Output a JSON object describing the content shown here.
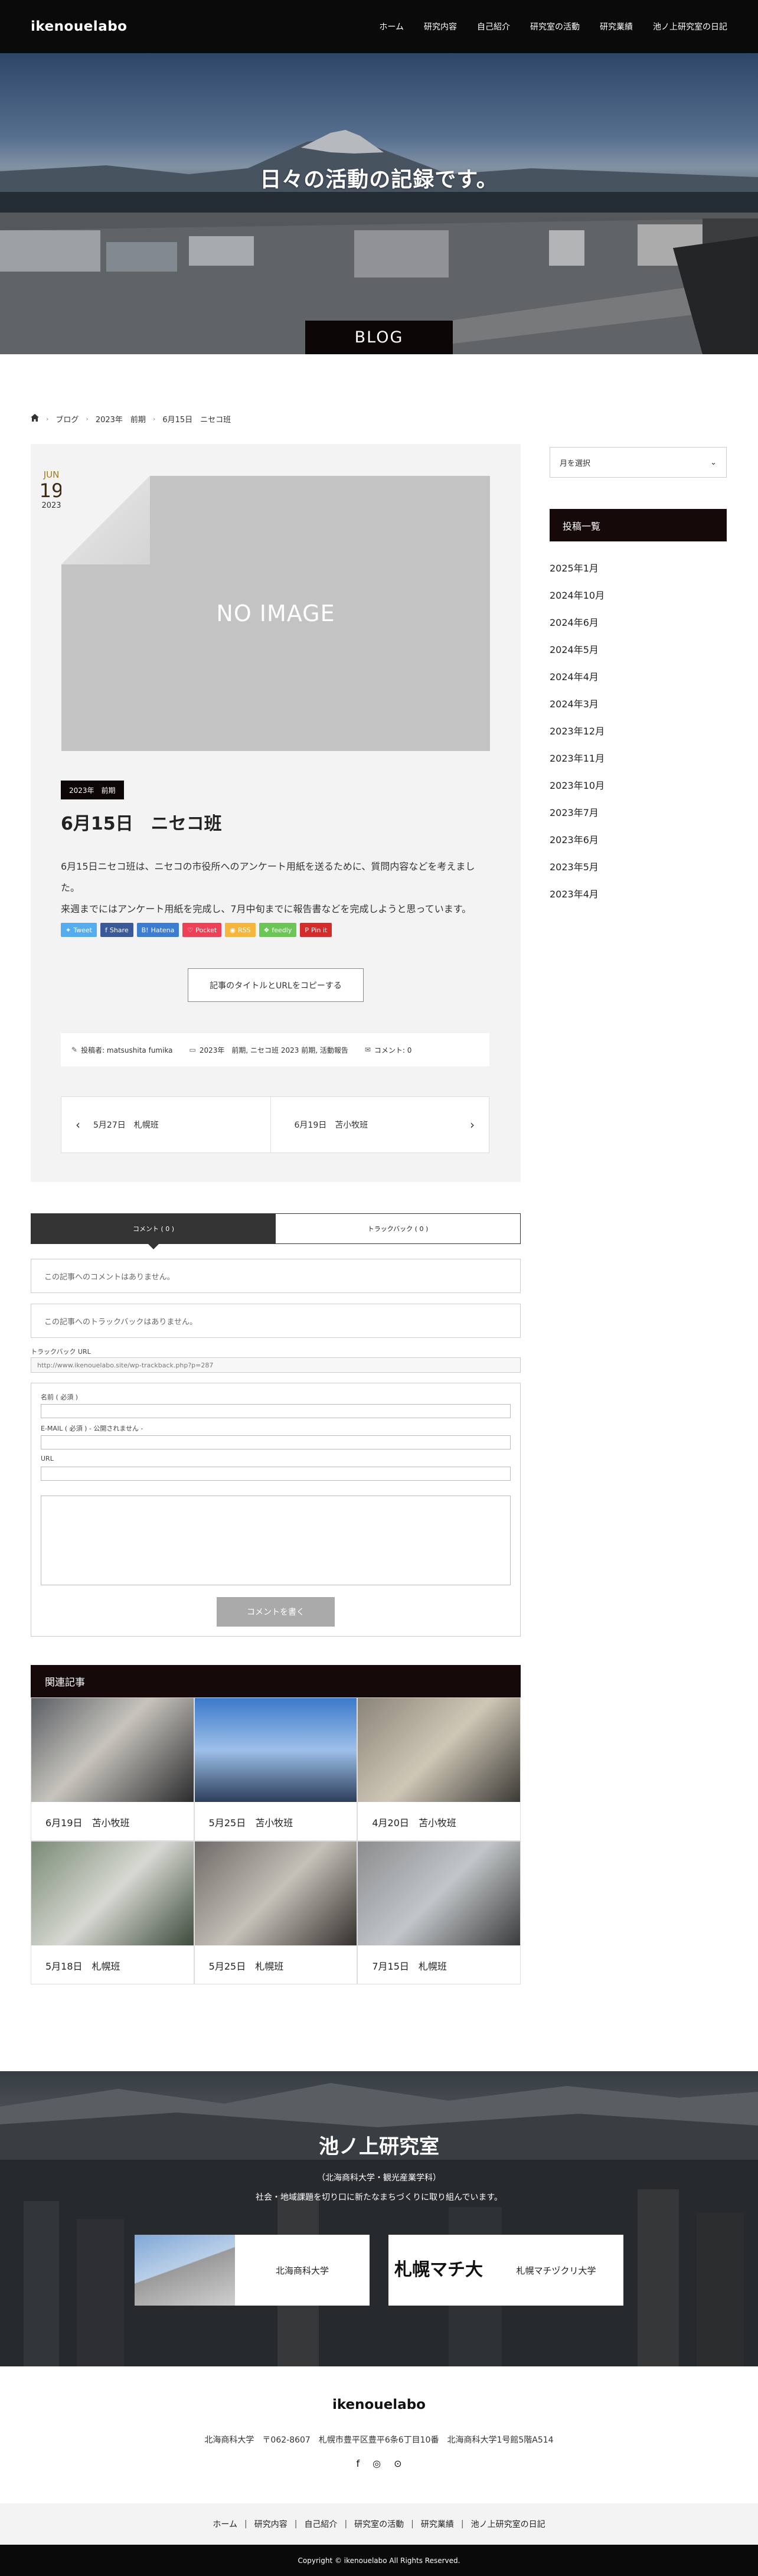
{
  "header": {
    "logo": "ikenouelabo",
    "nav": [
      "ホーム",
      "研究内容",
      "自己紹介",
      "研究室の活動",
      "研究業績",
      "池ノ上研究室の日記"
    ]
  },
  "hero": {
    "title": "日々の活動の記録です。",
    "tag": "BLOG"
  },
  "breadcrumb": {
    "home_icon": "home-icon",
    "items": [
      "ブログ",
      "2023年　前期",
      "6月15日　ニセコ班"
    ]
  },
  "post": {
    "date": {
      "month": "JUN",
      "day": "19",
      "year": "2023"
    },
    "thumbnail_text": "NO IMAGE",
    "category": "2023年　前期",
    "title": "6月15日　ニセコ班",
    "body": [
      "6月15日ニセコ班は、ニセコの市役所へのアンケート用紙を送るために、質問内容などを考えました。",
      "来週までにはアンケート用紙を完成し、7月中旬までに報告書などを完成しようと思っています。"
    ],
    "share_buttons": [
      {
        "label": "Tweet",
        "color": "#55acee",
        "icon": "twitter-icon"
      },
      {
        "label": "Share",
        "color": "#3b5998",
        "icon": "facebook-icon"
      },
      {
        "label": "Hatena",
        "color": "#3c7dd1",
        "icon": "hatena-icon"
      },
      {
        "label": "Pocket",
        "color": "#ee4056",
        "icon": "pocket-icon"
      },
      {
        "label": "RSS",
        "color": "#f5b63b",
        "icon": "rss-icon"
      },
      {
        "label": "feedly",
        "color": "#6cc655",
        "icon": "feedly-icon"
      },
      {
        "label": "Pin it",
        "color": "#d42b2b",
        "icon": "pinterest-icon"
      }
    ],
    "copy_button": "記事のタイトルとURLをコピーする",
    "meta": {
      "author": "投稿者: matsushita fumika",
      "categories": "2023年　前期, ニセコ班 2023 前期, 活動報告",
      "comments": "コメント: 0"
    },
    "prev": "5月27日　札幌班",
    "next": "6月19日　苫小牧班"
  },
  "comments": {
    "tabs": [
      "コメント ( 0 )",
      "トラックバック ( 0 )"
    ],
    "no_comments": "この記事へのコメントはありません。",
    "no_trackbacks": "この記事へのトラックバックはありません。",
    "trackback_label": "トラックバック URL",
    "trackback_url": "http://www.ikenouelabo.site/wp-trackback.php?p=287",
    "form": {
      "name_label": "名前 ( 必須 )",
      "email_label": "E-MAIL ( 必須 ) - 公開されません -",
      "url_label": "URL",
      "submit": "コメントを書く"
    }
  },
  "related": {
    "heading": "関連記事",
    "items": [
      {
        "caption": "6月19日　苫小牧班",
        "colors": [
          "#5a5e63",
          "#c7c4bd",
          "#2b2b2d"
        ]
      },
      {
        "caption": "5月25日　苫小牧班",
        "colors": [
          "#3c79c9",
          "#9dc0ea",
          "#2c3e5a"
        ]
      },
      {
        "caption": "4月20日　苫小牧班",
        "colors": [
          "#8a8478",
          "#cfc7b6",
          "#3c3a36"
        ]
      },
      {
        "caption": "5月18日　札幌班",
        "colors": [
          "#7a8a76",
          "#d7d9d2",
          "#3d4a3c"
        ]
      },
      {
        "caption": "5月25日　札幌班",
        "colors": [
          "#6e6a66",
          "#c5c0b8",
          "#34312e"
        ]
      },
      {
        "caption": "7月15日　札幌班",
        "colors": [
          "#8b8d8f",
          "#c2c6c8",
          "#3a3b3c"
        ]
      }
    ]
  },
  "sidebar": {
    "select_label": "月を選択",
    "heading": "投稿一覧",
    "months": [
      "2025年1月",
      "2024年10月",
      "2024年6月",
      "2024年5月",
      "2024年4月",
      "2024年3月",
      "2023年12月",
      "2023年11月",
      "2023年10月",
      "2023年7月",
      "2023年6月",
      "2023年5月",
      "2023年4月"
    ]
  },
  "footer_banner": {
    "title": "池ノ上研究室",
    "sub1": "（北海商科大学・観光産業学科）",
    "sub2": "社会・地域課題を切り口に新たなまちづくりに取り組んでいます。",
    "cards": [
      "北海商科大学",
      "札幌マチヅクリ大学"
    ],
    "logo_text": "札幌マチ大"
  },
  "footer": {
    "title": "ikenouelabo",
    "address": "北海商科大学　〒062-8607　札幌市豊平区豊平6条6丁目10番　北海商科大学1号館5階A514",
    "social_icons": [
      "facebook-icon",
      "instagram-icon",
      "rss-icon"
    ],
    "nav": [
      "ホーム",
      "研究内容",
      "自己紹介",
      "研究室の活動",
      "研究業績",
      "池ノ上研究室の日記"
    ],
    "copyright": "Copyright © ikenouelabo All Rights Reserved."
  }
}
